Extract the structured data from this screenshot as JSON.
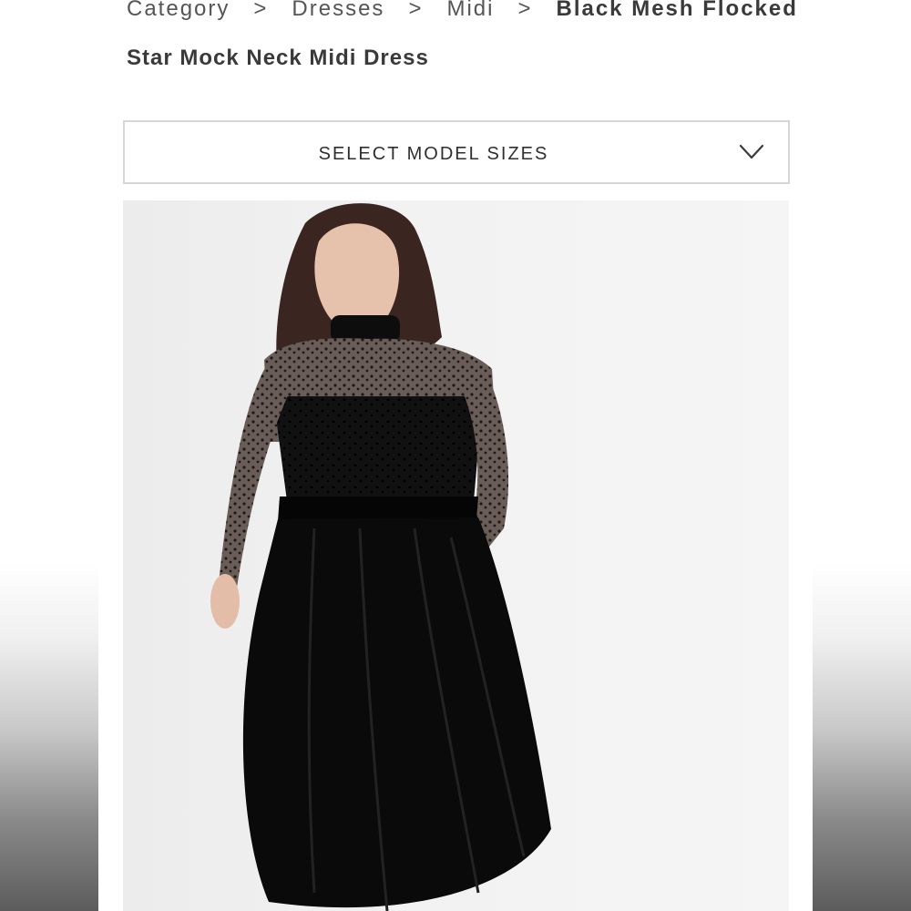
{
  "breadcrumb": {
    "items": [
      "Category",
      "Dresses",
      "Midi"
    ],
    "separator": ">",
    "current": "Black Mesh Flocked"
  },
  "product": {
    "title": "Star Mock Neck Midi Dress",
    "image_alt": "Model wearing black mesh flocked star mock neck midi dress"
  },
  "size_selector": {
    "label": "SELECT MODEL SIZES",
    "icon": "chevron-down-icon"
  },
  "colors": {
    "text": "#3a3a3a",
    "border": "#d6d6d6",
    "dress": "#0d0d0d"
  }
}
